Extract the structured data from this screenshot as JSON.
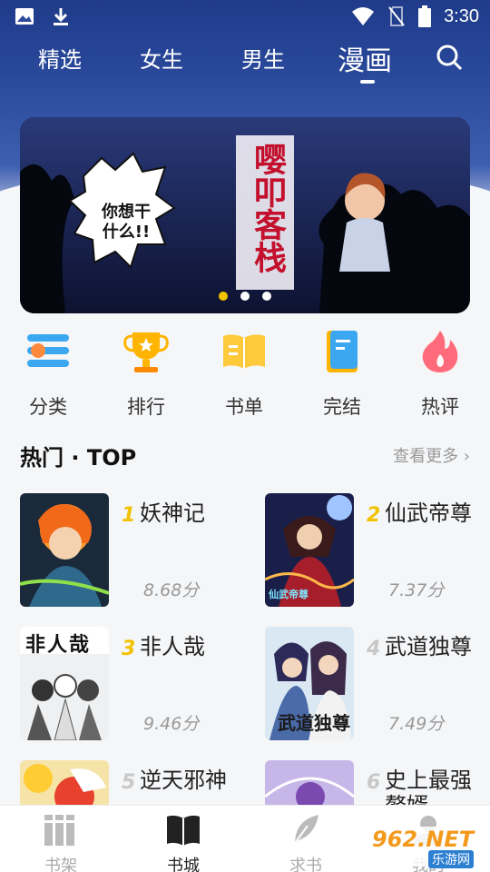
{
  "status_bar": {
    "time": "3:30"
  },
  "tabs": [
    {
      "label": "精选"
    },
    {
      "label": "女生"
    },
    {
      "label": "男生"
    },
    {
      "label": "漫画"
    }
  ],
  "banner": {
    "speech": "你想干\n什么!!",
    "title": "嘤叩客栈"
  },
  "categories": [
    {
      "label": "分类"
    },
    {
      "label": "排行"
    },
    {
      "label": "书单"
    },
    {
      "label": "完结"
    },
    {
      "label": "热评"
    }
  ],
  "section": {
    "title": "热门 · TOP",
    "more": "查看更多 ›"
  },
  "books": [
    {
      "rank": "1",
      "name": "妖神记",
      "score": "8.68分"
    },
    {
      "rank": "2",
      "name": "仙武帝尊",
      "score": "7.37分"
    },
    {
      "rank": "3",
      "name": "非人哉",
      "score": "9.46分"
    },
    {
      "rank": "4",
      "name": "武道独尊",
      "score": "7.49分"
    },
    {
      "rank": "5",
      "name": "逆天邪神",
      "score": ""
    },
    {
      "rank": "6",
      "name": "史上最强赘婿",
      "score": ""
    }
  ],
  "cover_text": {
    "book2": "仙武帝尊",
    "book3": "非人哉",
    "book4": "武道独尊"
  },
  "bottom_nav": [
    {
      "label": "书架"
    },
    {
      "label": "书城"
    },
    {
      "label": "求书"
    },
    {
      "label": "我的"
    }
  ],
  "watermark": {
    "text": "962.NET",
    "sub": "乐游网"
  },
  "colors": {
    "accent": "#f2c300",
    "rank_gold": "#f2c300",
    "rank_gray": "#c8c8c8",
    "header_blue": "#2b4a9c"
  }
}
